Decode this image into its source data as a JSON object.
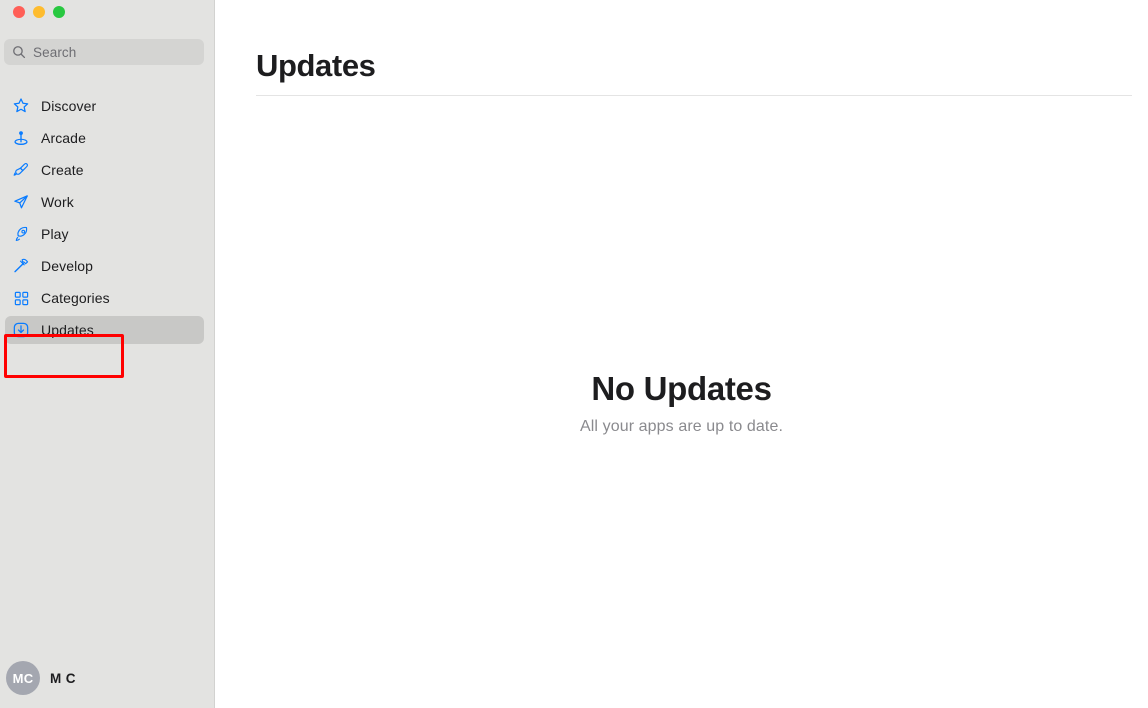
{
  "window": {
    "traffic_lights": [
      {
        "name": "close",
        "color": "#ff5f57"
      },
      {
        "name": "minimize",
        "color": "#febc2e"
      },
      {
        "name": "maximize",
        "color": "#28c840"
      }
    ]
  },
  "search": {
    "placeholder": "Search",
    "value": "",
    "icon": "search-icon"
  },
  "sidebar": {
    "items": [
      {
        "label": "Discover",
        "icon": "star-icon",
        "selected": false
      },
      {
        "label": "Arcade",
        "icon": "joystick-icon",
        "selected": false
      },
      {
        "label": "Create",
        "icon": "paintbrush-icon",
        "selected": false
      },
      {
        "label": "Work",
        "icon": "paper-plane-icon",
        "selected": false
      },
      {
        "label": "Play",
        "icon": "rocket-icon",
        "selected": false
      },
      {
        "label": "Develop",
        "icon": "hammer-icon",
        "selected": false
      },
      {
        "label": "Categories",
        "icon": "grid-icon",
        "selected": false
      },
      {
        "label": "Updates",
        "icon": "download-circle-icon",
        "selected": true
      }
    ],
    "account": {
      "initials": "MC",
      "name": "M C"
    }
  },
  "main": {
    "title": "Updates",
    "empty_state": {
      "title": "No Updates",
      "subtitle": "All your apps are up to date."
    }
  },
  "colors": {
    "accent": "#0a7cff",
    "sidebar_bg": "#e3e3e1",
    "selection_bg": "#c8c8c6",
    "highlight_outline": "#ff0000",
    "text_primary": "#1d1d1f",
    "text_secondary": "#8a8a8e"
  }
}
